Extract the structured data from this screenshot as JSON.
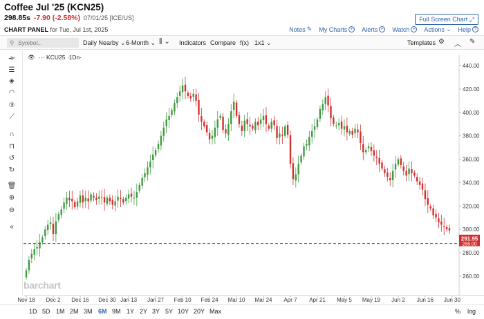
{
  "header": {
    "title": "Coffee Jul '25 (KCN25)",
    "last": "298.85s",
    "change": "-7.90 (-2.58%)",
    "date_src": "07/01/25 [ICE/US]",
    "full_screen": "Full Screen Chart ⤢",
    "panel_bold": "CHART PANEL",
    "panel_rest": "for Tue, Jul 1st, 2025",
    "links": [
      "Notes",
      "My Charts",
      "Alerts",
      "Watch",
      "Actions",
      "Help"
    ]
  },
  "toolbar": {
    "symbol_placeholder": "Symbol...",
    "items": [
      "Daily Nearby",
      "6-Month",
      "Indicators",
      "Compare",
      "f(x)",
      "1x1"
    ],
    "templates": "Templates"
  },
  "legend": {
    "symbol": "KCU25",
    "interval": "·1Dn·"
  },
  "icons": {
    "left_tools": [
      "crosshair-icon",
      "lines-icon",
      "shapes-icon",
      "arc-icon",
      "number-icon",
      "pattern-icon",
      "magnet-icon",
      "lock-icon",
      "undo-icon",
      "redo-icon",
      "trash-icon",
      "zoom-in-icon",
      "zoom-out-icon",
      "collapse-icon"
    ],
    "toolbar": [
      "search-icon",
      "candles-icon",
      "settings-icon",
      "chevron-up-icon"
    ],
    "bottom": [
      "settings-icon"
    ]
  },
  "watermark": "barchart",
  "range_buttons": [
    "1D",
    "5D",
    "1M",
    "2M",
    "3M",
    "6M",
    "9M",
    "1Y",
    "2Y",
    "3Y",
    "5Y",
    "10Y",
    "20Y",
    "Max"
  ],
  "range_active": "6M",
  "range_right": [
    "%",
    "log"
  ],
  "colors": {
    "up": "#3f9a3f",
    "down": "#d2302f",
    "accent": "#2f63b0",
    "last_price_line": "#d2302f"
  },
  "chart_data": {
    "type": "candlestick",
    "title": "",
    "xlabel": "",
    "ylabel": "",
    "ylim": [
      250,
      450
    ],
    "yticks": [
      260,
      280,
      300,
      320,
      340,
      360,
      380,
      400,
      420,
      440
    ],
    "ytick_labels": [
      "260.00",
      "280.00",
      "300.00",
      "320.00",
      "340.00",
      "360.00",
      "380.00",
      "400.00",
      "420.00",
      "440.00"
    ],
    "xticks": [
      {
        "label": "Nov 18",
        "index": 0
      },
      {
        "label": "Dec 2",
        "index": 10
      },
      {
        "label": "Dec 16",
        "index": 20
      },
      {
        "label": "Dec 30",
        "index": 30
      },
      {
        "label": "Jan 13",
        "index": 38
      },
      {
        "label": "Jan 27",
        "index": 48
      },
      {
        "label": "Feb 10",
        "index": 58
      },
      {
        "label": "Feb 24",
        "index": 68
      },
      {
        "label": "Mar 10",
        "index": 78
      },
      {
        "label": "Mar 24",
        "index": 88
      },
      {
        "label": "Apr 7",
        "index": 98
      },
      {
        "label": "Apr 21",
        "index": 108
      },
      {
        "label": "May 5",
        "index": 118
      },
      {
        "label": "May 19",
        "index": 128
      },
      {
        "label": "Jun 2",
        "index": 138
      },
      {
        "label": "Jun 16",
        "index": 148
      },
      {
        "label": "Jun 30",
        "index": 158
      }
    ],
    "close_labels": [
      "291.95",
      "288.00"
    ],
    "price_line": 288.0,
    "closes": [
      265,
      274,
      279,
      283,
      285,
      289,
      293,
      300,
      304,
      306,
      296,
      307,
      313,
      317,
      323,
      327,
      325,
      324,
      319,
      324,
      329,
      323,
      327,
      324,
      330,
      327,
      325,
      328,
      327,
      323,
      327,
      324,
      321,
      324,
      328,
      326,
      323,
      327,
      330,
      328,
      327,
      332,
      338,
      344,
      348,
      353,
      358,
      364,
      368,
      373,
      380,
      387,
      394,
      397,
      402,
      408,
      413,
      418,
      423,
      418,
      414,
      412,
      416,
      410,
      398,
      392,
      388,
      383,
      377,
      380,
      387,
      394,
      397,
      385,
      382,
      390,
      401,
      409,
      397,
      390,
      384,
      393,
      390,
      388,
      386,
      392,
      389,
      394,
      397,
      390,
      386,
      392,
      389,
      378,
      382,
      380,
      388,
      381,
      356,
      343,
      347,
      356,
      363,
      371,
      373,
      379,
      384,
      388,
      394,
      403,
      407,
      413,
      406,
      395,
      390,
      389,
      391,
      386,
      388,
      383,
      384,
      381,
      386,
      383,
      374,
      366,
      368,
      371,
      367,
      363,
      361,
      356,
      352,
      348,
      345,
      342,
      350,
      356,
      360,
      355,
      350,
      346,
      352,
      348,
      346,
      341,
      338,
      334,
      326,
      321,
      318,
      312,
      310,
      306,
      304,
      302,
      300,
      299
    ]
  }
}
